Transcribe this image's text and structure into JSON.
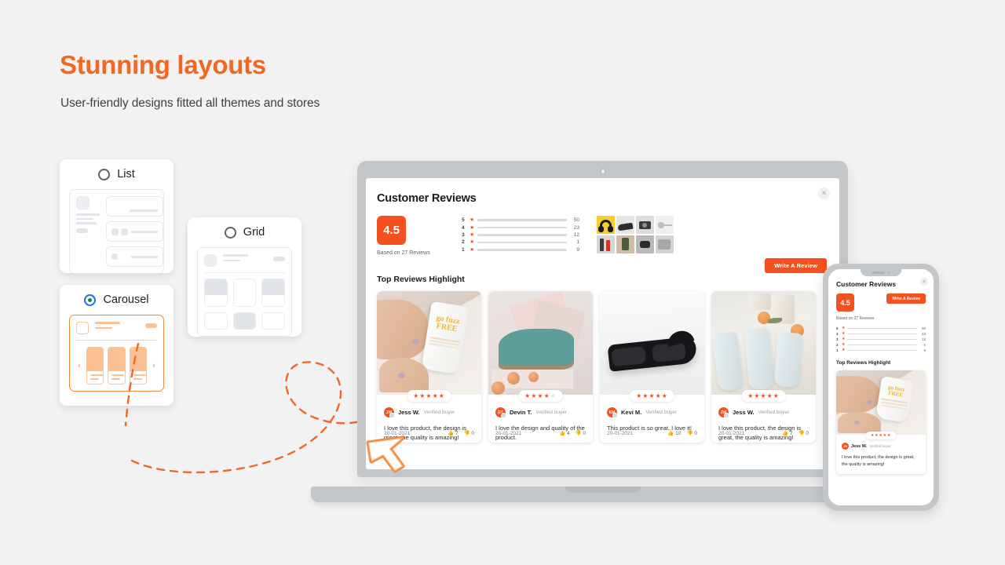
{
  "hero": {
    "title": "Stunning layouts",
    "subtitle": "User-friendly designs fitted all themes and stores",
    "accent_color": "#f26722"
  },
  "layout_options": [
    {
      "id": "list",
      "label": "List",
      "selected": false
    },
    {
      "id": "grid",
      "label": "Grid",
      "selected": false
    },
    {
      "id": "carousel",
      "label": "Carousel",
      "selected": true
    }
  ],
  "reviews_widget": {
    "title": "Customer Reviews",
    "close_label": "×",
    "average_score": "4.5",
    "based_on": "Based on 27 Reviews",
    "write_review_label": "Write A Review",
    "section_title": "Top Reviews Highlight",
    "rating_breakdown": [
      {
        "stars": "5",
        "count": "50",
        "percent": 88
      },
      {
        "stars": "4",
        "count": "23",
        "percent": 55
      },
      {
        "stars": "3",
        "count": "12",
        "percent": 33
      },
      {
        "stars": "2",
        "count": "1",
        "percent": 13
      },
      {
        "stars": "1",
        "count": "9",
        "percent": 29
      }
    ],
    "gallery_thumbs": [
      "headphones-thumb",
      "sneaker-thumb",
      "camera-thumb",
      "cable-thumb",
      "lipstick-thumb",
      "bottle-hand-thumb",
      "watch-hand-thumb",
      "tool-thumb"
    ],
    "reviews": [
      {
        "photo": "cream-tube-photo",
        "photo_text": "go fuzz FREE",
        "stars": 5,
        "stars_display": "★★★★★",
        "initials": "JW",
        "name": "Jess W.",
        "badge": "Verified buyer",
        "text": "I love this product, the design is great, the quality is amazing!",
        "date": "20-01-2021",
        "upvotes": "7",
        "downvotes": "0"
      },
      {
        "photo": "green-shoe-photo",
        "photo_text": "",
        "stars": 4,
        "stars_display": "★★★★",
        "initials": "DT",
        "name": "Devin T.",
        "badge": "Verified buyer",
        "text": "I love the design and quality of the product.",
        "date": "20-01-2021",
        "upvotes": "4",
        "downvotes": "0"
      },
      {
        "photo": "sunglasses-photo",
        "photo_text": "",
        "stars": 5,
        "stars_display": "★★★★★",
        "initials": "KM",
        "name": "Kevi M.",
        "badge": "Verified buyer",
        "text": "This product is so great, I love it!",
        "date": "20-01-2021",
        "upvotes": "10",
        "downvotes": "0"
      },
      {
        "photo": "bottles-photo",
        "photo_text": "",
        "stars": 5,
        "stars_display": "★★★★★",
        "initials": "JW",
        "name": "Jess W.",
        "badge": "Verified buyer",
        "text": "I love this product, the design is great, the quality is amazing!",
        "date": "20-01-2021",
        "upvotes": "7",
        "downvotes": "0"
      }
    ]
  },
  "phone_widget": {
    "title": "Customer Reviews",
    "close_label": "×",
    "average_score": "4.5",
    "write_review_label": "Write A Review",
    "based_on": "Based on 27 Reviews",
    "section_title": "Top Reviews Highlight",
    "review": {
      "photo": "cream-tube-photo",
      "photo_text": "go fuzz FREE",
      "stars_display": "★★★★★",
      "initials": "JW",
      "name": "Jess W.",
      "badge": "Verified buyer",
      "text": "I love this product, the design is great, the quality is amazing!"
    }
  },
  "icons": {
    "thumb_up": "👍",
    "thumb_down": "👎",
    "prev_arrow": "‹",
    "next_arrow": "›"
  },
  "colors": {
    "accent": "#f26722",
    "score_bg": "#f4511e",
    "page_bg": "#f2f2f2",
    "device_frame": "#c4c7ca"
  }
}
